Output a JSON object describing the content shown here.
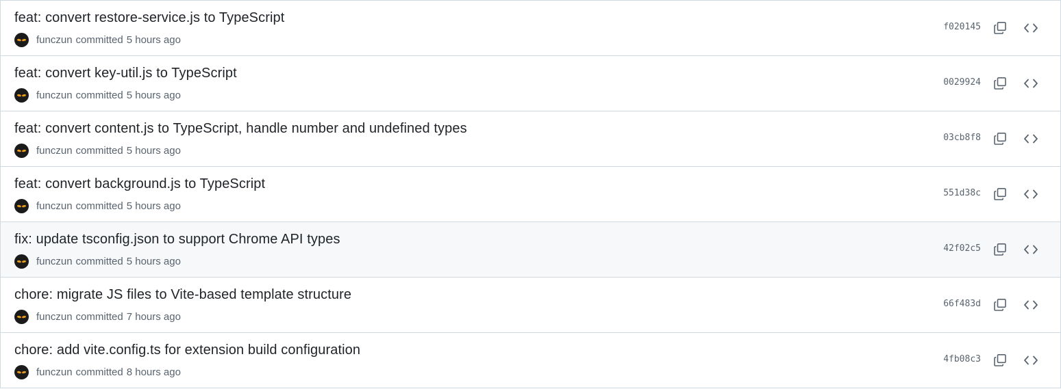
{
  "commits": [
    {
      "title": "feat: convert restore-service.js to TypeScript",
      "author": "funczun",
      "action": "committed",
      "time": "5 hours ago",
      "sha": "f020145"
    },
    {
      "title": "feat: convert key-util.js to TypeScript",
      "author": "funczun",
      "action": "committed",
      "time": "5 hours ago",
      "sha": "0029924"
    },
    {
      "title": "feat: convert content.js to TypeScript, handle number and undefined types",
      "author": "funczun",
      "action": "committed",
      "time": "5 hours ago",
      "sha": "03cb8f8"
    },
    {
      "title": "feat: convert background.js to TypeScript",
      "author": "funczun",
      "action": "committed",
      "time": "5 hours ago",
      "sha": "551d38c"
    },
    {
      "title": "fix: update tsconfig.json to support Chrome API types",
      "author": "funczun",
      "action": "committed",
      "time": "5 hours ago",
      "sha": "42f02c5"
    },
    {
      "title": "chore: migrate JS files to Vite-based template structure",
      "author": "funczun",
      "action": "committed",
      "time": "7 hours ago",
      "sha": "66f483d"
    },
    {
      "title": "chore: add vite.config.ts for extension build configuration",
      "author": "funczun",
      "action": "committed",
      "time": "8 hours ago",
      "sha": "4fb08c3"
    }
  ],
  "hovered_row_index": 4,
  "icons": {
    "copy": "copy-icon",
    "browse": "code-icon",
    "avatar": "avatar-icon"
  },
  "colors": {
    "border": "#d1d9e0",
    "hover_bg": "#f6f8fa",
    "text_primary": "#1f2328",
    "text_muted": "#59636e"
  }
}
